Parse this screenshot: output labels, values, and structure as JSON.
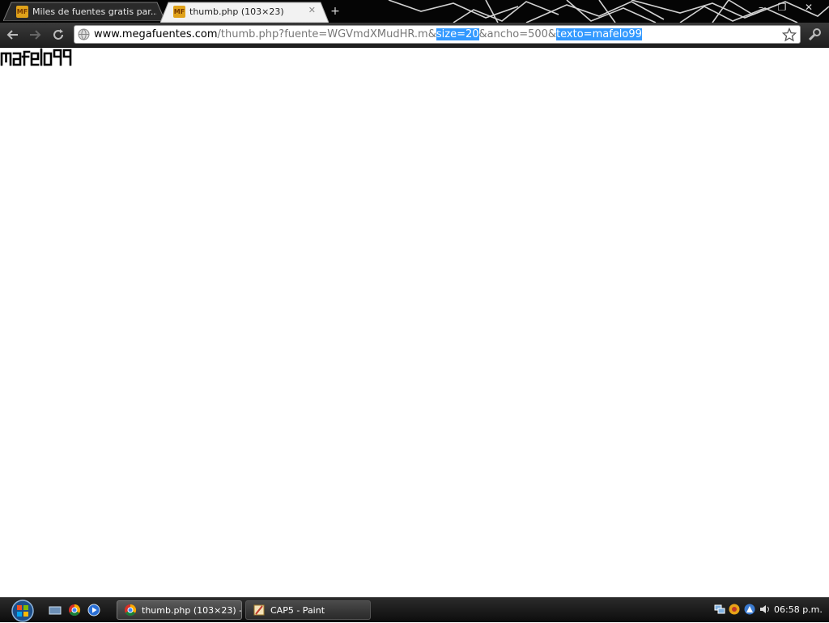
{
  "browser": {
    "tabs": [
      {
        "favicon_text": "MF",
        "title": "Miles de fuentes gratis par...",
        "active": false
      },
      {
        "favicon_text": "MF",
        "title": "thumb.php (103×23)",
        "active": true
      }
    ],
    "new_tab_label": "+",
    "window_controls": {
      "minimize": "–",
      "maximize": "❐",
      "close": "✕"
    },
    "address": {
      "host": "www.megafuentes.com",
      "path_before": "/thumb.php?fuente=WGVmdXMudHR.m&",
      "selected_1": "size=20",
      "middle": "&ancho=500&",
      "selected_2": "texto=mafelo99"
    }
  },
  "page": {
    "rendered_text": "mafelo99"
  },
  "taskbar": {
    "windows": [
      {
        "label": "thumb.php (103×23) -...",
        "icon": "chrome-icon",
        "active": true
      },
      {
        "label": "CAP5 - Paint",
        "icon": "paint-icon",
        "active": false
      }
    ],
    "clock": "06:58 p.m."
  },
  "colors": {
    "selection": "#3399ff",
    "favicon": "#e0a21a",
    "theme_background": "#050505"
  }
}
